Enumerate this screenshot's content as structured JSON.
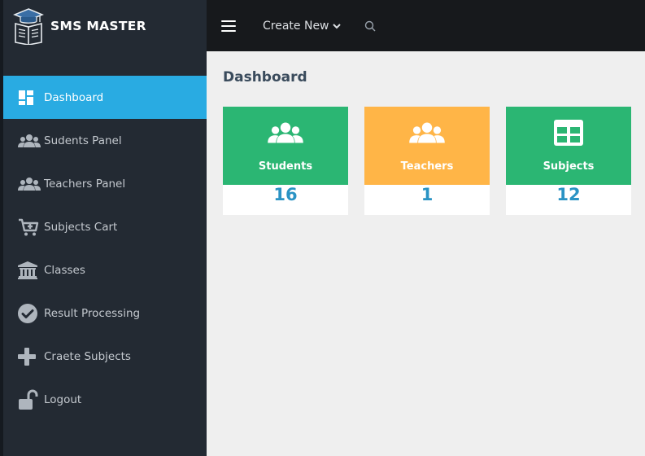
{
  "brand": {
    "name": "SMS MASTER",
    "logo_icon": "graduation-book-icon"
  },
  "colors": {
    "sidebar_bg": "#232a33",
    "topbar_bg": "#17191c",
    "active_item": "#29abe2",
    "content_bg": "#efefef",
    "students_card": "#2bb673",
    "teachers_card": "#ffb547",
    "subjects_card": "#2bb673",
    "value_text": "#2a93c4"
  },
  "sidebar": {
    "items": [
      {
        "label": "Dashboard",
        "icon": "dashboard-icon",
        "active": true
      },
      {
        "label": "Sudents Panel",
        "icon": "users-icon"
      },
      {
        "label": "Teachers Panel",
        "icon": "users-icon"
      },
      {
        "label": "Subjects Cart",
        "icon": "cart-plus-icon"
      },
      {
        "label": "Classes",
        "icon": "institution-icon"
      },
      {
        "label": "Result Processing",
        "icon": "check-circle-icon"
      },
      {
        "label": "Craete Subjects",
        "icon": "plus-icon"
      },
      {
        "label": "Logout",
        "icon": "unlock-icon"
      }
    ]
  },
  "topbar": {
    "menu_icon": "hamburger-icon",
    "create_new_label": "Create New",
    "caret_icon": "chevron-down-icon",
    "search_icon": "search-icon"
  },
  "main": {
    "title": "Dashboard",
    "cards": [
      {
        "label": "Students",
        "value": "16",
        "icon": "users-icon"
      },
      {
        "label": "Teachers",
        "value": "1",
        "icon": "users-icon"
      },
      {
        "label": "Subjects",
        "value": "12",
        "icon": "table-icon"
      }
    ]
  }
}
